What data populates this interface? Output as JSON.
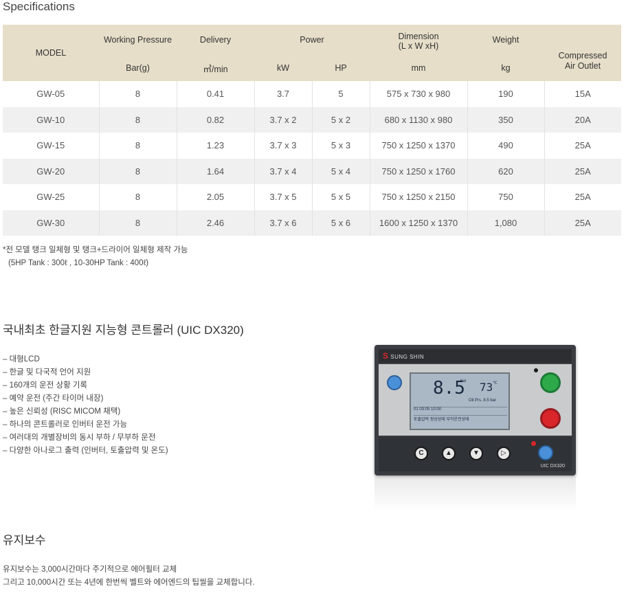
{
  "specs": {
    "title": "Specifications",
    "headers": {
      "model": "MODEL",
      "working_pressure": "Working Pressure",
      "delivery": "Delivery",
      "power": "Power",
      "dimension_line1": "Dimension",
      "dimension_line2": "(L x W xH)",
      "weight": "Weight",
      "outlet_line1": "Compressed",
      "outlet_line2": "Air Outlet",
      "unit_pressure": "Bar(g)",
      "unit_delivery": "㎥/min",
      "unit_kw": "kW",
      "unit_hp": "HP",
      "unit_dim": "mm",
      "unit_weight": "kg"
    },
    "rows": [
      [
        "GW-05",
        "8",
        "0.41",
        "3.7",
        "5",
        "575 x 730 x 980",
        "190",
        "15A"
      ],
      [
        "GW-10",
        "8",
        "0.82",
        "3.7 x 2",
        "5 x 2",
        "680 x 1130 x 980",
        "350",
        "20A"
      ],
      [
        "GW-15",
        "8",
        "1.23",
        "3.7 x 3",
        "5 x 3",
        "750 x 1250 x 1370",
        "490",
        "25A"
      ],
      [
        "GW-20",
        "8",
        "1.64",
        "3.7 x 4",
        "5 x 4",
        "750 x 1250 x 1760",
        "620",
        "25A"
      ],
      [
        "GW-25",
        "8",
        "2.05",
        "3.7 x 5",
        "5 x 5",
        "750 x 1250 x 2150",
        "750",
        "25A"
      ],
      [
        "GW-30",
        "8",
        "2.46",
        "3.7 x 6",
        "5 x 6",
        "1600 x 1250 x 1370",
        "1,080",
        "25A"
      ]
    ],
    "note_line1": "*전 모델 탱크 일체형 및 탱크+드라이어 일체형 제작 가능",
    "note_line2": "(5HP Tank : 300ℓ , 10-30HP Tank : 400ℓ)"
  },
  "controller": {
    "title": "국내최초 한글지원 지능형 콘트롤러 (UIC DX320)",
    "features": [
      "– 대형LCD",
      "– 한글 및 다국적 언어 지원",
      "– 160개의 운전 상황 기록",
      "– 예약 운전 (주간 타이머 내장)",
      "– 높은 신뢰성 (RISC MICOM 채택)",
      "– 하나의 콘트롤러로 인버터 운전 가능",
      "– 여러대의 개별장비의 동시 부하 / 무부하 운전",
      "– 다양한 아나로그 출력 (인버터, 토출압력 및 온도)"
    ],
    "device": {
      "brand": "SUNG SHIN",
      "pressure": "8.5",
      "pressure_unit": "bar",
      "temperature": "73",
      "temp_unit": "℃",
      "oil_pressure": "Oil Prs.  8.5 bar",
      "time_row": "01  03:05                 10:00",
      "status_row": "토출압력  정상상태  부하운전상태",
      "model_tag": "UIC DX320"
    }
  },
  "maintenance": {
    "title": "유지보수",
    "line1": "유지보수는 3,000시간마다 주기적으로 에어필터 교체",
    "line2": "그리고 10,000시간 또는 4년에 한번씩 벨트와 에어엔드의 팁씰을 교체합니다."
  }
}
